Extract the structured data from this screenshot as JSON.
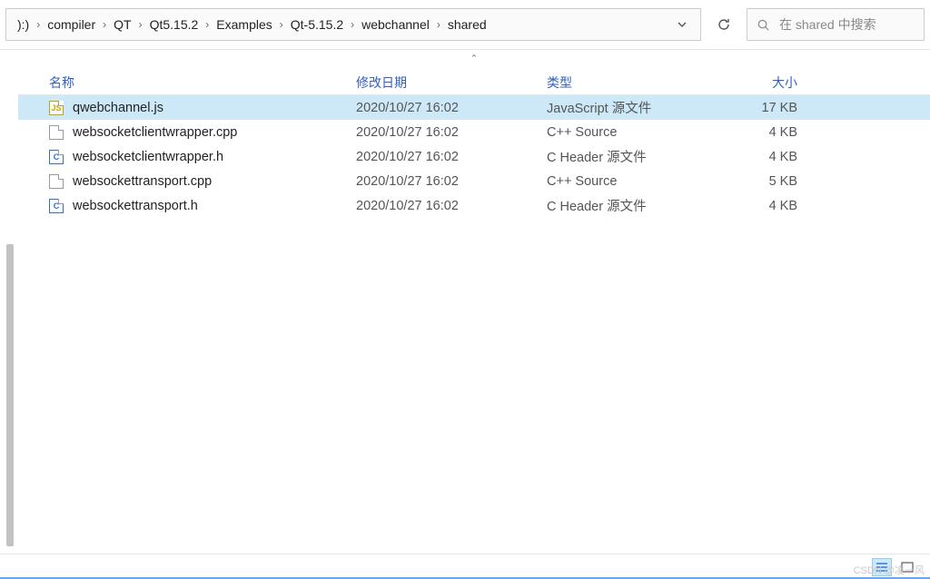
{
  "breadcrumb": {
    "drive": "):)",
    "items": [
      "compiler",
      "QT",
      "Qt5.15.2",
      "Examples",
      "Qt-5.15.2",
      "webchannel",
      "shared"
    ]
  },
  "search": {
    "placeholder": "在 shared 中搜索"
  },
  "columns": {
    "name": "名称",
    "date": "修改日期",
    "type": "类型",
    "size": "大小"
  },
  "files": [
    {
      "icon": "js",
      "icon_label": "JS",
      "name": "qwebchannel.js",
      "date": "2020/10/27 16:02",
      "type": "JavaScript 源文件",
      "size": "17 KB",
      "selected": true
    },
    {
      "icon": "blank",
      "icon_label": "",
      "name": "websocketclientwrapper.cpp",
      "date": "2020/10/27 16:02",
      "type": "C++ Source",
      "size": "4 KB",
      "selected": false
    },
    {
      "icon": "c",
      "icon_label": "C",
      "name": "websocketclientwrapper.h",
      "date": "2020/10/27 16:02",
      "type": "C Header 源文件",
      "size": "4 KB",
      "selected": false
    },
    {
      "icon": "blank",
      "icon_label": "",
      "name": "websockettransport.cpp",
      "date": "2020/10/27 16:02",
      "type": "C++ Source",
      "size": "5 KB",
      "selected": false
    },
    {
      "icon": "c",
      "icon_label": "C",
      "name": "websockettransport.h",
      "date": "2020/10/27 16:02",
      "type": "C Header 源文件",
      "size": "4 KB",
      "selected": false
    }
  ],
  "watermark": "CSDN @凌一风"
}
